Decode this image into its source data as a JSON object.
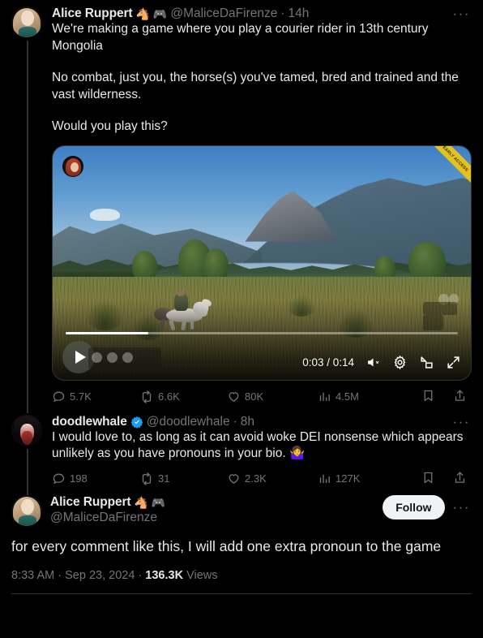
{
  "tweet1": {
    "display_name": "Alice Ruppert",
    "name_emojis": [
      "🐴",
      "🎮"
    ],
    "handle": "@MaliceDaFirenze",
    "separator": "·",
    "timestamp": "14h",
    "more_label": "···",
    "paragraphs": [
      "We're making a game where you play a courier rider in 13th century Mongolia",
      "No combat, just you, the horse(s) you've tamed, bred and trained and the vast wilderness.",
      "Would you play this?"
    ],
    "video": {
      "current_time": "0:03",
      "total_time": "0:14",
      "time_display": "0:03 / 0:14",
      "progress_percent": 21,
      "muted": true,
      "corner_banner_text": "EARLY ACCESS"
    },
    "actions": {
      "replies": "5.7K",
      "reposts": "6.6K",
      "likes": "80K",
      "views": "4.5M"
    }
  },
  "tweet2": {
    "display_name": "doodlewhale",
    "verified": true,
    "handle": "@doodlewhale",
    "separator": "·",
    "timestamp": "8h",
    "more_label": "···",
    "text": "I would love to, as long as it can avoid woke DEI nonsense which appears unlikely as you have pronouns in your bio. 🤷‍♀️",
    "actions": {
      "replies": "198",
      "reposts": "31",
      "likes": "2.3K",
      "views": "127K"
    }
  },
  "tweet3": {
    "display_name": "Alice Ruppert",
    "name_emojis": [
      "🐴",
      "🎮"
    ],
    "handle": "@MaliceDaFirenze",
    "follow_label": "Follow",
    "more_label": "···",
    "text": "for every comment like this, I will add one extra pronoun to the game",
    "meta_time": "8:33 AM",
    "meta_sep1": "·",
    "meta_date": "Sep 23, 2024",
    "meta_sep2": "·",
    "meta_views_count": "136.3K",
    "meta_views_label": "Views"
  },
  "colors": {
    "background": "#000000",
    "text": "#e7e9ea",
    "muted": "#71767b",
    "border": "#2f3336",
    "verified_blue": "#1d9bf0",
    "follow_bg": "#eff3f4",
    "banner_yellow": "#e3c21e"
  }
}
